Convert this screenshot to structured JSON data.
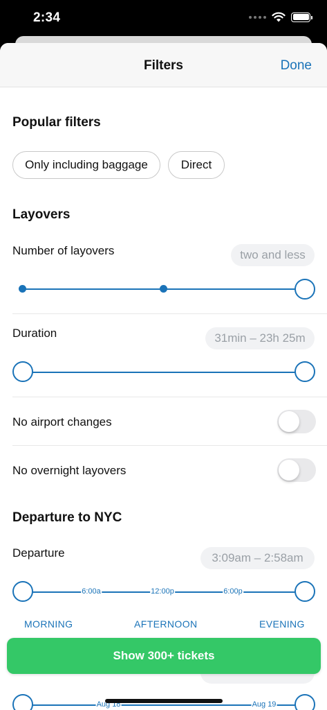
{
  "status_bar": {
    "time": "2:34"
  },
  "nav": {
    "title": "Filters",
    "done_label": "Done"
  },
  "popular_filters": {
    "title": "Popular filters",
    "chips": [
      "Only including baggage",
      "Direct"
    ]
  },
  "layovers": {
    "title": "Layovers",
    "number": {
      "label": "Number of layovers",
      "value": "two and less"
    },
    "duration": {
      "label": "Duration",
      "value": "31min – 23h 25m"
    },
    "no_airport_changes": {
      "label": "No airport changes",
      "enabled": false
    },
    "no_overnight": {
      "label": "No overnight layovers",
      "enabled": false
    }
  },
  "departure_section": {
    "title": "Departure to NYC",
    "departure": {
      "label": "Departure",
      "value": "3:09am – 2:58am"
    },
    "ticks": [
      "6:00a",
      "12:00p",
      "6:00p"
    ],
    "dayparts": [
      "MORNING",
      "AFTERNOON",
      "EVENING"
    ],
    "date_ticks": [
      "Aug 18",
      "Aug 19"
    ]
  },
  "cta": {
    "label": "Show 300+ tickets"
  },
  "colors": {
    "accent": "#1a73b8",
    "cta": "#34c867"
  }
}
